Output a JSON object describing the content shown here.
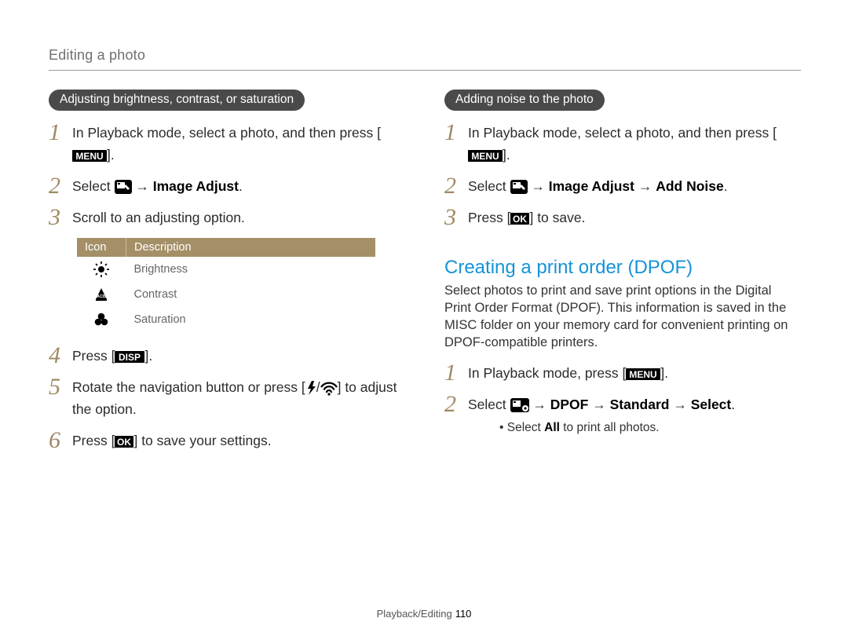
{
  "breadcrumb": "Editing a photo",
  "left": {
    "pill": "Adjusting brightness, contrast, or saturation",
    "steps": {
      "s1": "In Playback mode, select a photo, and then press [",
      "s1b": "].",
      "s2a": "Select ",
      "s2b": " → ",
      "s2c": "Image Adjust",
      "s2d": ".",
      "s3": "Scroll to an adjusting option.",
      "s4a": "Press [",
      "s4b": "].",
      "s5a": "Rotate the navigation button or press [",
      "s5b": "/",
      "s5c": "] to adjust the option.",
      "s6a": "Press [",
      "s6b": "] to save your settings."
    },
    "table": {
      "h1": "Icon",
      "h2": "Description",
      "rows": [
        {
          "desc": "Brightness"
        },
        {
          "desc": "Contrast"
        },
        {
          "desc": "Saturation"
        }
      ]
    }
  },
  "right": {
    "pill": "Adding noise to the photo",
    "steps": {
      "s1": "In Playback mode, select a photo, and then press [",
      "s1b": "].",
      "s2a": "Select ",
      "s2b": " → ",
      "s2c": "Image Adjust",
      "s2d": " → ",
      "s2e": "Add Noise",
      "s2f": ".",
      "s3a": "Press [",
      "s3b": "] to save."
    },
    "section_title": "Creating a print order (DPOF)",
    "intro": "Select photos to print and save print options in the Digital Print Order Format (DPOF). This information is saved in the MISC folder on your memory card for convenient printing on DPOF-compatible printers.",
    "dpof": {
      "s1a": "In Playback mode, press [",
      "s1b": "].",
      "s2a": "Select ",
      "s2b": " → ",
      "s2c": "DPOF",
      "s2d": " → ",
      "s2e": "Standard",
      "s2f": " → ",
      "s2g": "Select",
      "s2h": ".",
      "sub_a": "• Select ",
      "sub_b": "All",
      "sub_c": " to print all photos."
    }
  },
  "footer": {
    "section": "Playback/Editing",
    "page": "110"
  }
}
